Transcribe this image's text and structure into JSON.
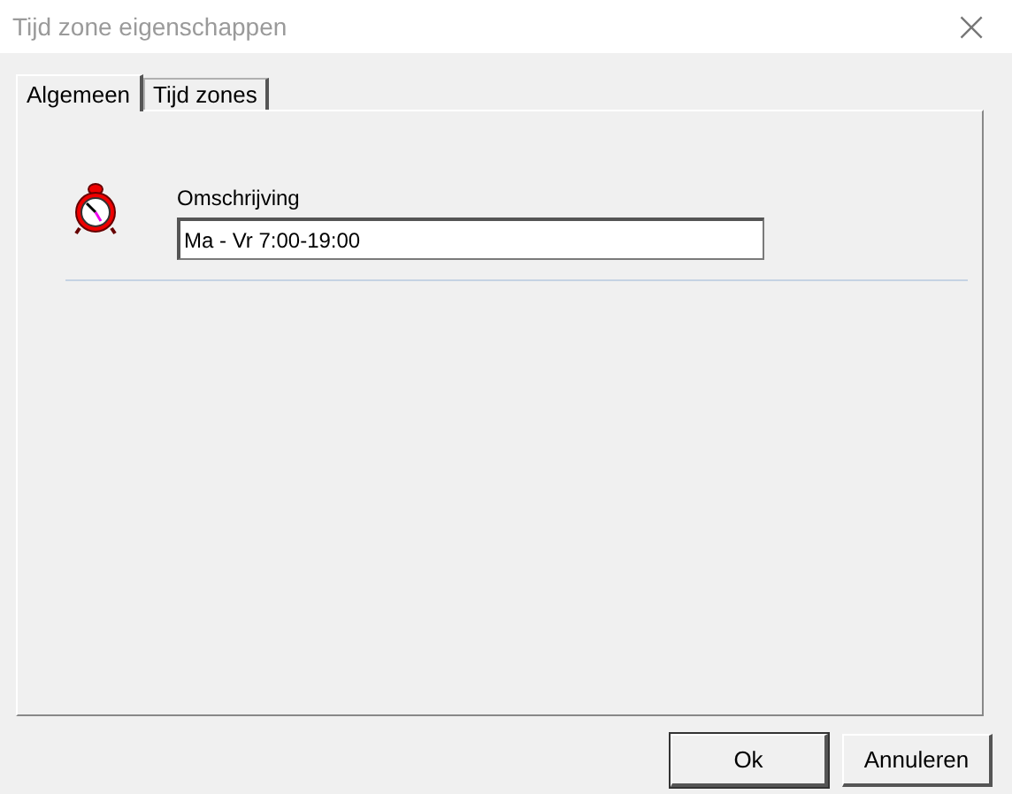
{
  "window": {
    "title": "Tijd zone eigenschappen",
    "close": "×"
  },
  "tabs": [
    {
      "label": "Algemeen",
      "selected": true
    },
    {
      "label": "Tijd zones",
      "selected": false
    }
  ],
  "description": {
    "label": "Omschrijving",
    "value": "Ma - Vr 7:00-19:00"
  },
  "buttons": [
    {
      "label": "Ok",
      "kind": "default"
    },
    {
      "label": "Annuleren",
      "kind": "normal"
    }
  ]
}
